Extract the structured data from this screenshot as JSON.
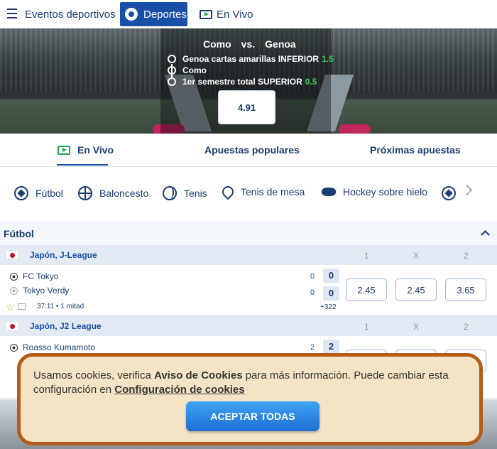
{
  "nav": {
    "eventos": "Eventos deportivos",
    "deportes": "Deportes",
    "en_vivo": "En Vivo"
  },
  "banner": {
    "home": "Como",
    "vs": "vs.",
    "away": "Genoa",
    "selections": [
      {
        "text": "Genoa cartas amarillas INFERIOR",
        "odd": "1.5"
      },
      {
        "text": "Como",
        "odd": ""
      },
      {
        "text": "1er semestre total SUPERIOR",
        "odd": "0.5"
      }
    ],
    "total_odds": "4.91"
  },
  "tabs": {
    "live": "En Vivo",
    "popular": "Apuestas populares",
    "upcoming": "Próximas apuestas"
  },
  "sports": [
    "Fútbol",
    "Baloncesto",
    "Tenis",
    "Tenis de mesa",
    "Hockey sobre hielo"
  ],
  "section": {
    "title": "Fútbol"
  },
  "columns": {
    "c1": "1",
    "cx": "X",
    "c2": "2"
  },
  "leagues": [
    {
      "name": "Japón, J-League",
      "match": {
        "home": "FC Tokyo",
        "away": "Tokyo Verdy",
        "home_score": "0",
        "away_score": "0",
        "home_box": "0",
        "away_box": "0",
        "time": "37:11 • 1 mitad",
        "more": "+322",
        "odds": [
          "2.45",
          "2.45",
          "3.65"
        ]
      }
    },
    {
      "name": "Japón, J2 League",
      "match": {
        "home": "Roasso Kumamoto",
        "home_score": "2",
        "home_box": "2"
      }
    }
  ],
  "cookie": {
    "t1": "Usamos cookies, verifica ",
    "link1": "Aviso de Cookies",
    "t2": " para más información. Puede cambiar esta configuración en ",
    "link2": "Configuración de cookies",
    "accept": "ACEPTAR TODAS"
  }
}
